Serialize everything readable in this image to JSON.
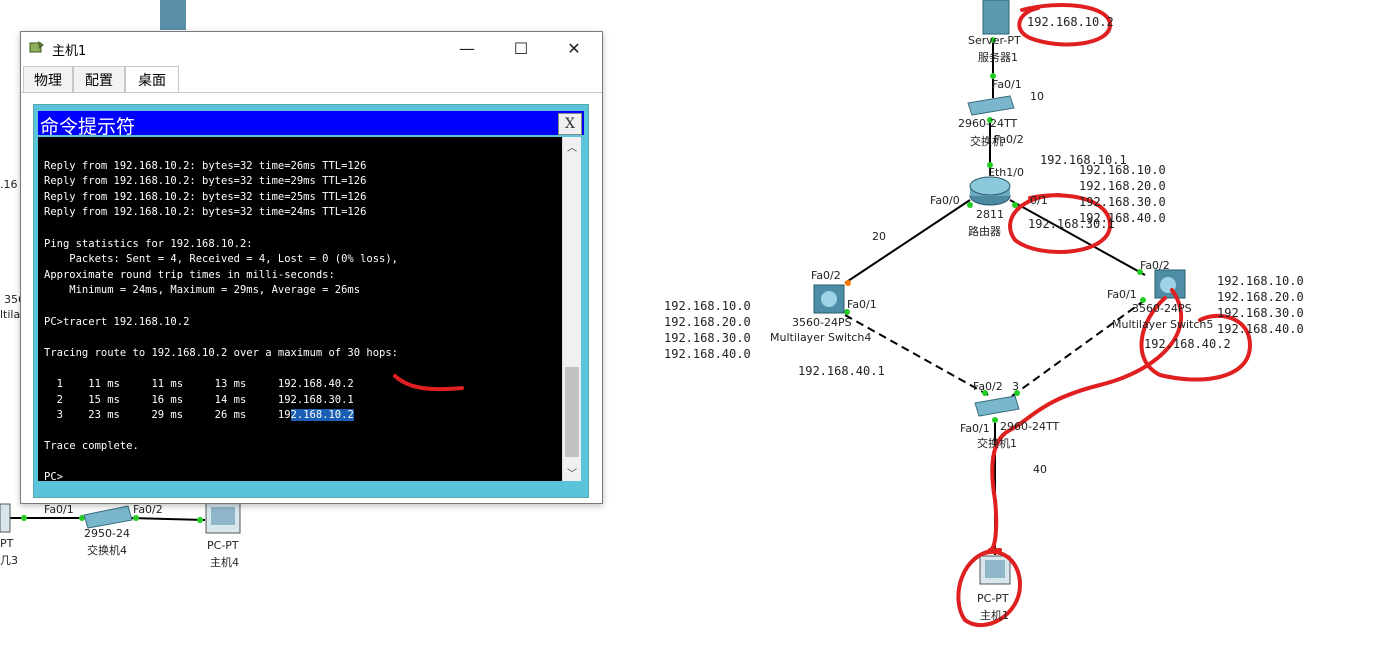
{
  "window": {
    "title": "主机1",
    "controls": {
      "minimize": "—",
      "maximize": "☐",
      "close": "✕"
    },
    "tabs": [
      {
        "label": "物理"
      },
      {
        "label": "配置"
      },
      {
        "label": "桌面",
        "active": true
      }
    ]
  },
  "cmd": {
    "title": "命令提示符",
    "close": "X",
    "lines": [
      "",
      "Reply from 192.168.10.2: bytes=32 time=26ms TTL=126",
      "Reply from 192.168.10.2: bytes=32 time=29ms TTL=126",
      "Reply from 192.168.10.2: bytes=32 time=25ms TTL=126",
      "Reply from 192.168.10.2: bytes=32 time=24ms TTL=126",
      "",
      "Ping statistics for 192.168.10.2:",
      "    Packets: Sent = 4, Received = 4, Lost = 0 (0% loss),",
      "Approximate round trip times in milli-seconds:",
      "    Minimum = 24ms, Maximum = 29ms, Average = 26ms",
      "",
      "PC>tracert 192.168.10.2",
      "",
      "Tracing route to 192.168.10.2 over a maximum of 30 hops:",
      "",
      "  1    11 ms     11 ms     13 ms     192.168.40.2",
      "  2    15 ms     16 ms     14 ms     192.168.30.1",
      "  3    23 ms     29 ms     26 ms     192.168.10.2",
      "",
      "Trace complete.",
      "",
      "PC>"
    ],
    "highlight_text": "2.168.10.2"
  },
  "topology": {
    "server": {
      "model": "Server-PT",
      "name": "服务器1",
      "ip": "192.168.10.2"
    },
    "switch_top": {
      "model": "2960-24TT",
      "name": "交换机",
      "port_up": "Fa0/1",
      "port_down": "Fa0/2",
      "vlan": "10"
    },
    "router": {
      "model": "2811",
      "name": "路由器",
      "port_top": "Eth1/0",
      "port_left": "Fa0/0",
      "port_right": "0/1",
      "ip_top": "192.168.10.1",
      "ip_right": "192.168.30.1",
      "routes": [
        "192.168.10.0",
        "192.168.20.0",
        "192.168.30.0",
        "192.168.40.0"
      ]
    },
    "ml_switch4": {
      "model": "3560-24PS",
      "name": "Multilayer Switch4",
      "port_top": "Fa0/2",
      "port_right": "Fa0/1",
      "routes": [
        "192.168.10.0",
        "192.168.20.0",
        "192.168.30.0",
        "192.168.40.0"
      ],
      "ip": "192.168.40.1",
      "link_label": "20"
    },
    "ml_switch5": {
      "model": "3560-24PS",
      "name": "Multilayer Switch5",
      "port_top": "Fa0/2",
      "port_left": "Fa0/1",
      "routes": [
        "192.168.10.0",
        "192.168.20.0",
        "192.168.30.0",
        "192.168.40.0"
      ],
      "ip": "192.168.40.2"
    },
    "switch1": {
      "model": "2960-24TT",
      "name": "交换机1",
      "port_top": "Fa0/2",
      "port_top2": "3",
      "port_bottom": "Fa0/1",
      "vlan": "40"
    },
    "pc1": {
      "model": "PC-PT",
      "name": "主机1"
    },
    "bottom_left": {
      "switch4": {
        "model": "2950-24",
        "name": "交换机4",
        "port_left": "Fa0/1",
        "port_right": "Fa0/2"
      },
      "pc4": {
        "model": "PC-PT",
        "name": "主机4"
      },
      "pc3_model_fragment": "PT",
      "pc3_name_fragment": "几3"
    },
    "left_fragments": {
      "ip": ".16",
      "model": "356",
      "name": "ltila"
    }
  },
  "colors": {
    "cmd_title": "#0000ff",
    "cmd_frame": "#5cc4da",
    "annotation": "#e02020",
    "link_green": "#22cc22"
  }
}
